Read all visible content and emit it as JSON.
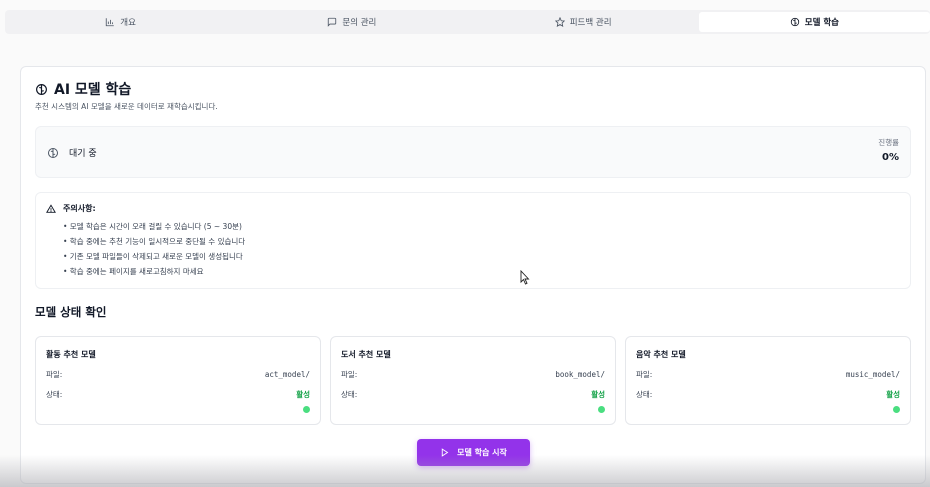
{
  "tabs": [
    {
      "label": "개요",
      "icon": "bar-chart-icon",
      "active": false
    },
    {
      "label": "문의 관리",
      "icon": "message-square-icon",
      "active": false
    },
    {
      "label": "피드백 관리",
      "icon": "star-icon",
      "active": false
    },
    {
      "label": "모델 학습",
      "icon": "brain-icon",
      "active": true
    }
  ],
  "page": {
    "title": "AI 모델 학습",
    "subtitle": "추천 시스템의 AI 모델을 새로운 데이터로 재학습시킵니다."
  },
  "status": {
    "state": "대기 중",
    "progress_label": "진행률",
    "progress_value": "0%",
    "progress": 0
  },
  "warning": {
    "title": "주의사항:",
    "items": [
      "• 모델 학습은 시간이 오래 걸릴 수 있습니다 (5 ~ 30분)",
      "• 학습 중에는 추천 기능이 일시적으로 중단될 수 있습니다",
      "• 기존 모델 파일들이 삭제되고 새로운 모델이 생성됩니다",
      "• 학습 중에는 페이지를 새로고침하지 마세요"
    ]
  },
  "models_section": {
    "title": "모델 상태 확인",
    "models": [
      {
        "name": "활동 추천 모델",
        "file_label": "파일:",
        "file": "act_model/",
        "status_label": "상태:",
        "status": "활성",
        "status_color": "#16a34a"
      },
      {
        "name": "도서 추천 모델",
        "file_label": "파일:",
        "file": "book_model/",
        "status_label": "상태:",
        "status": "활성",
        "status_color": "#16a34a"
      },
      {
        "name": "음악 추천 모델",
        "file_label": "파일:",
        "file": "music_model/",
        "status_label": "상태:",
        "status": "활성",
        "status_color": "#16a34a"
      }
    ]
  },
  "actions": {
    "start_label": "모델 학습 시작"
  },
  "colors": {
    "accent": "#9333ea",
    "active_status": "#16a34a",
    "status_dot": "#4ade80"
  }
}
